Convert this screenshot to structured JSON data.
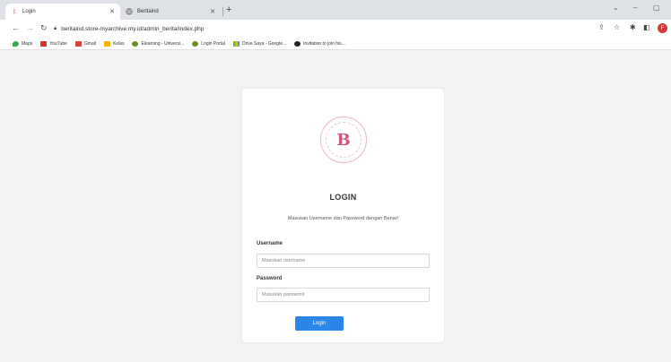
{
  "browser": {
    "tabs": [
      {
        "label": "Login",
        "favicon": "pink-logo-icon"
      },
      {
        "label": "Beritaind",
        "favicon": "globe-icon"
      }
    ],
    "url": "beritaind.store-myarchive.my.id/admin_berita/index.php",
    "profile_initial": "F",
    "bookmarks": [
      {
        "label": "Maps",
        "color": "#34a853"
      },
      {
        "label": "YouTube",
        "color": "#e52d27"
      },
      {
        "label": "Gmail",
        "color": "#d44638"
      },
      {
        "label": "Kelas",
        "color": "#f4b400"
      },
      {
        "label": "Elearning - Universi...",
        "color": "#6b8e23"
      },
      {
        "label": "Login Portal",
        "color": "#6b8e23"
      },
      {
        "label": "Drive Saya - Google...",
        "color": "#4285f4"
      },
      {
        "label": "Invitation to join his...",
        "color": "#222222"
      }
    ]
  },
  "login": {
    "title": "LOGIN",
    "subtitle": "Masukan Username dan Password dengan Benar!",
    "username_label": "Username",
    "username_placeholder": "Masukan username",
    "password_label": "Password",
    "password_placeholder": "Masukan password",
    "button_label": "Login",
    "button_color": "#2a86e8",
    "logo_letter": "B",
    "brand_color": "#d0577f"
  }
}
